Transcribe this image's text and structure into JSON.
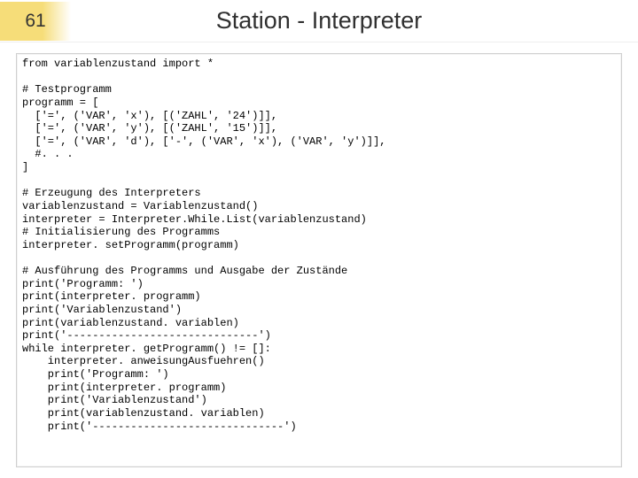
{
  "slide_number": "61",
  "title": "Station - Interpreter",
  "code": "from variablenzustand import *\n\n# Testprogramm\nprogramm = [\n  ['=', ('VAR', 'x'), [('ZAHL', '24')]],\n  ['=', ('VAR', 'y'), [('ZAHL', '15')]],\n  ['=', ('VAR', 'd'), ['-', ('VAR', 'x'), ('VAR', 'y')]],\n  #. . .\n]\n\n# Erzeugung des Interpreters\nvariablenzustand = Variablenzustand()\ninterpreter = Interpreter.While.List(variablenzustand)\n# Initialisierung des Programms\ninterpreter. setProgramm(programm)\n\n# Ausführung des Programms und Ausgabe der Zustände\nprint('Programm: ')\nprint(interpreter. programm)\nprint('Variablenzustand')\nprint(variablenzustand. variablen)\nprint('------------------------------')\nwhile interpreter. getProgramm() != []:\n    interpreter. anweisungAusfuehren()\n    print('Programm: ')\n    print(interpreter. programm)\n    print('Variablenzustand')\n    print(variablenzustand. variablen)\n    print('------------------------------')"
}
